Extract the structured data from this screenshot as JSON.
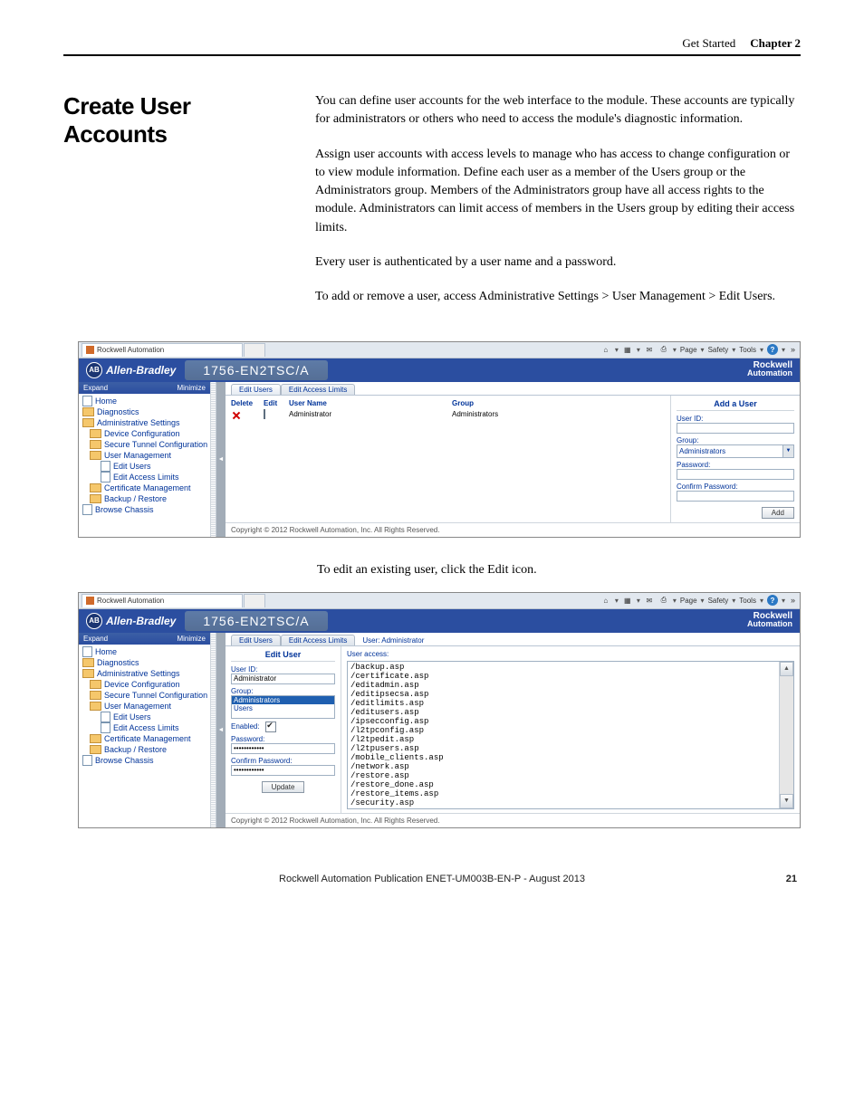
{
  "header": {
    "section": "Get Started",
    "chapter": "Chapter 2"
  },
  "heading": "Create User Accounts",
  "paragraphs": {
    "p1": "You can define user accounts for the web interface to the module. These accounts are typically for administrators or others who need to access the module's diagnostic information.",
    "p2": "Assign user accounts with access levels to manage who has access to change configuration or to view module information. Define each user as a member of the Users group or the Administrators group. Members of the Administrators group have all access rights to the module. Administrators can limit access of members in the Users group by editing their access limits.",
    "p3": "Every user is authenticated by a user name and a password.",
    "p4": "To add or remove a user, access Administrative Settings > User Management > Edit Users.",
    "mid": "To edit an existing user, click the Edit icon."
  },
  "ie": {
    "tab_title": "Rockwell Automation",
    "tools": {
      "page": "Page",
      "safety": "Safety",
      "tools": "Tools"
    }
  },
  "banner": {
    "ab_abbrev": "AB",
    "ab": "Allen-Bradley",
    "model": "1756-EN2TSC/A",
    "ra1": "Rockwell",
    "ra2": "Automation"
  },
  "sidebar": {
    "expand": "Expand",
    "minimize": "Minimize",
    "items": [
      "Home",
      "Diagnostics",
      "Administrative Settings",
      "Device Configuration",
      "Secure Tunnel Configuration",
      "User Management",
      "Edit Users",
      "Edit Access Limits",
      "Certificate Management",
      "Backup / Restore",
      "Browse Chassis"
    ]
  },
  "shot1": {
    "tabs": {
      "a": "Edit Users",
      "b": "Edit Access Limits"
    },
    "cols": {
      "del": "Delete",
      "edit": "Edit",
      "name": "User Name",
      "grp": "Group"
    },
    "row": {
      "name": "Administrator",
      "grp": "Administrators"
    },
    "panel": {
      "title": "Add a User",
      "uid": "User ID:",
      "grp": "Group:",
      "grp_val": "Administrators",
      "pwd": "Password:",
      "cpwd": "Confirm Password:",
      "btn": "Add"
    },
    "copyright": "Copyright © 2012 Rockwell Automation, Inc. All Rights Reserved."
  },
  "shot2": {
    "tabs": {
      "a": "Edit Users",
      "b": "Edit Access Limits",
      "crumb": "User: Administrator"
    },
    "form": {
      "title": "Edit User",
      "uid": "User ID:",
      "uid_val": "Administrator",
      "grp": "Group:",
      "grp_opts": [
        "Administrators",
        "Users"
      ],
      "enabled": "Enabled:",
      "pwd": "Password:",
      "pwd_val": "************",
      "cpwd": "Confirm Password:",
      "cpwd_val": "************",
      "btn": "Update"
    },
    "access": {
      "label": "User access:",
      "items": [
        "/backup.asp",
        "/certificate.asp",
        "/editadmin.asp",
        "/editipsecsa.asp",
        "/editlimits.asp",
        "/editusers.asp",
        "/ipsecconfig.asp",
        "/l2tpconfig.asp",
        "/l2tpedit.asp",
        "/l2tpusers.asp",
        "/mobile_clients.asp",
        "/network.asp",
        "/restore.asp",
        "/restore_done.asp",
        "/restore_items.asp",
        "/security.asp"
      ]
    },
    "copyright": "Copyright © 2012 Rockwell Automation, Inc. All Rights Reserved."
  },
  "footer": {
    "pub": "Rockwell Automation Publication ENET-UM003B-EN-P - August 2013",
    "page": "21"
  }
}
